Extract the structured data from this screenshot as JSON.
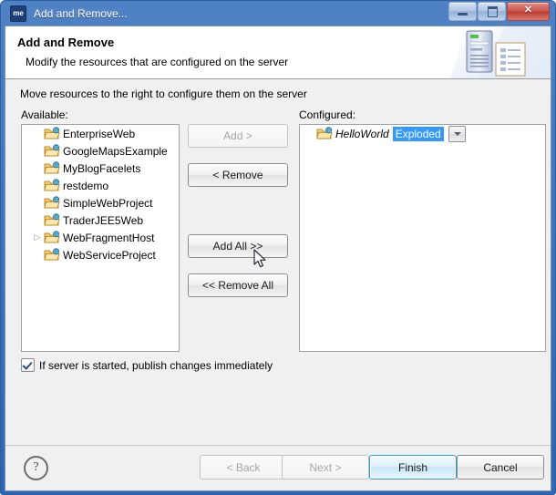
{
  "window": {
    "title": "Add and Remove...",
    "icon_name": "app-icon",
    "icon_text": "me",
    "controls": {
      "minimize": "minimize",
      "maximize": "maximize",
      "close": "✕"
    }
  },
  "header": {
    "title": "Add and Remove",
    "subtitle": "Modify the resources that are configured on the server",
    "banner_icon": "server-and-document-icon"
  },
  "main": {
    "instruction": "Move resources to the right to configure them on the server",
    "available_label": "Available:",
    "configured_label": "Configured:",
    "available_items": [
      {
        "label": "EnterpriseWeb",
        "expandable": false
      },
      {
        "label": "GoogleMapsExample",
        "expandable": false
      },
      {
        "label": "MyBlogFacelets",
        "expandable": false
      },
      {
        "label": "restdemo",
        "expandable": false
      },
      {
        "label": "SimpleWebProject",
        "expandable": false
      },
      {
        "label": "TraderJEE5Web",
        "expandable": false
      },
      {
        "label": "WebFragmentHost",
        "expandable": true
      },
      {
        "label": "WebServiceProject",
        "expandable": false
      }
    ],
    "configured_items": [
      {
        "label": "HelloWorld",
        "combo_value": "Exploded"
      }
    ],
    "buttons": {
      "add": "Add >",
      "remove": "< Remove",
      "add_all": "Add All >>",
      "remove_all": "<< Remove All"
    },
    "publish_checkbox": {
      "label": "If server is started, publish changes immediately",
      "checked": true
    }
  },
  "footer": {
    "help": "?",
    "back": "< Back",
    "next": "Next >",
    "finish": "Finish",
    "cancel": "Cancel"
  },
  "colors": {
    "titlebar": "#3b74bd",
    "selection": "#3399ff",
    "default_button": "#2f9ad1",
    "body": "#f0f0f0"
  }
}
